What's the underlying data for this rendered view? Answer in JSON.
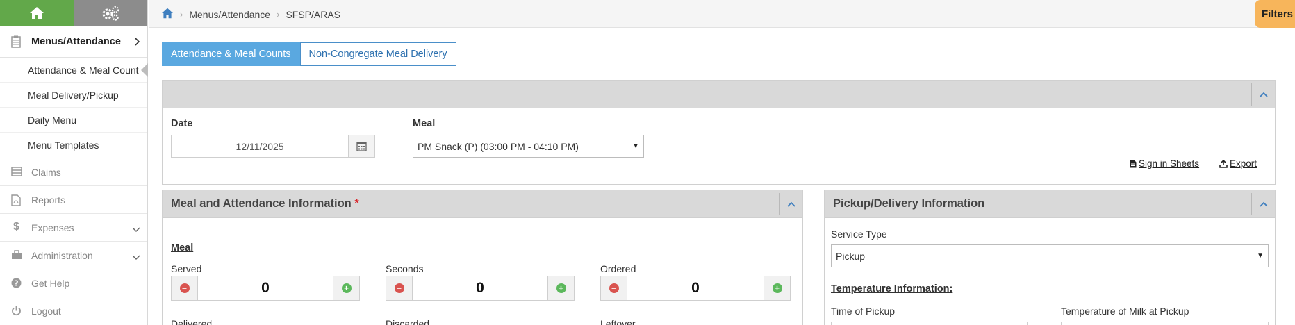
{
  "sidebar": {
    "menus_label": "Menus/Attendance",
    "subitems": [
      "Attendance & Meal Count",
      "Meal Delivery/Pickup",
      "Daily Menu",
      "Menu Templates"
    ],
    "items": [
      {
        "label": "Claims",
        "icon": "claims-icon"
      },
      {
        "label": "Reports",
        "icon": "reports-icon"
      },
      {
        "label": "Expenses",
        "icon": "dollar-icon"
      },
      {
        "label": "Administration",
        "icon": "briefcase-icon"
      },
      {
        "label": "Get Help",
        "icon": "help-icon"
      },
      {
        "label": "Logout",
        "icon": "power-icon"
      }
    ]
  },
  "header": {
    "breadcrumb": [
      "Menus/Attendance",
      "SFSP/ARAS"
    ],
    "filters_label": "Filters"
  },
  "tabs": [
    "Attendance & Meal Counts",
    "Non-Congregate Meal Delivery"
  ],
  "filter_panel": {
    "date_label": "Date",
    "date_value": "12/11/2025",
    "meal_label": "Meal",
    "meal_value": "PM Snack (P) (03:00 PM - 04:10 PM)",
    "sign_in_sheets": "Sign in Sheets",
    "export": "Export"
  },
  "meal_panel": {
    "title": "Meal and Attendance Information",
    "required_mark": "*",
    "section": "Meal",
    "counters": [
      {
        "label": "Served",
        "value": "0"
      },
      {
        "label": "Seconds",
        "value": "0"
      },
      {
        "label": "Ordered",
        "value": "0"
      }
    ],
    "next_labels": [
      "Delivered",
      "Discarded",
      "Leftover"
    ]
  },
  "pickup_panel": {
    "title": "Pickup/Delivery Information",
    "service_type_label": "Service Type",
    "service_type_value": "Pickup",
    "temperature_heading": "Temperature Information:",
    "time_of_pickup_label": "Time of Pickup",
    "milk_temp_label": "Temperature of Milk at Pickup"
  },
  "colors": {
    "home_green": "#62a84a",
    "tab_active": "#5aa8e0",
    "filters_orange": "#f7b55b",
    "required_red": "#d9262c"
  }
}
